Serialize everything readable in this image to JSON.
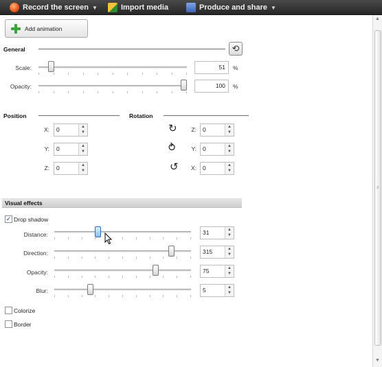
{
  "toolbar": {
    "record_label": "Record the screen",
    "import_label": "Import media",
    "produce_label": "Produce and share",
    "icons": [
      "record-icon",
      "import-media-icon",
      "produce-share-icon"
    ]
  },
  "add_animation": {
    "label": "Add animation"
  },
  "general": {
    "title": "General",
    "scale": {
      "label": "Scale:",
      "value": "51",
      "unit": "%",
      "level": 0.07
    },
    "opacity": {
      "label": "Opacity:",
      "value": "100",
      "unit": "%",
      "level": 1.0
    }
  },
  "position": {
    "title": "Position",
    "x": {
      "label": "X:",
      "value": "0"
    },
    "y": {
      "label": "Y:",
      "value": "0"
    },
    "z": {
      "label": "Z:",
      "value": "0"
    }
  },
  "rotation": {
    "title": "Rotation",
    "z": {
      "label": "Z:",
      "value": "0"
    },
    "y": {
      "label": "Y:",
      "value": "0"
    },
    "x": {
      "label": "X:",
      "value": "0"
    }
  },
  "visual_effects": {
    "title": "Visual effects",
    "drop_shadow": {
      "label": "Drop shadow",
      "checked": true
    },
    "distance": {
      "label": "Distance:",
      "value": "31",
      "level": 0.31
    },
    "direction": {
      "label": "Direction:",
      "value": "315",
      "level": 0.875
    },
    "opacity": {
      "label": "Opacity:",
      "value": "75",
      "level": 0.75
    },
    "blur": {
      "label": "Blur:",
      "value": "5",
      "level": 0.25
    },
    "colorize": {
      "label": "Colorize",
      "checked": false
    },
    "border": {
      "label": "Border",
      "checked": false
    }
  }
}
